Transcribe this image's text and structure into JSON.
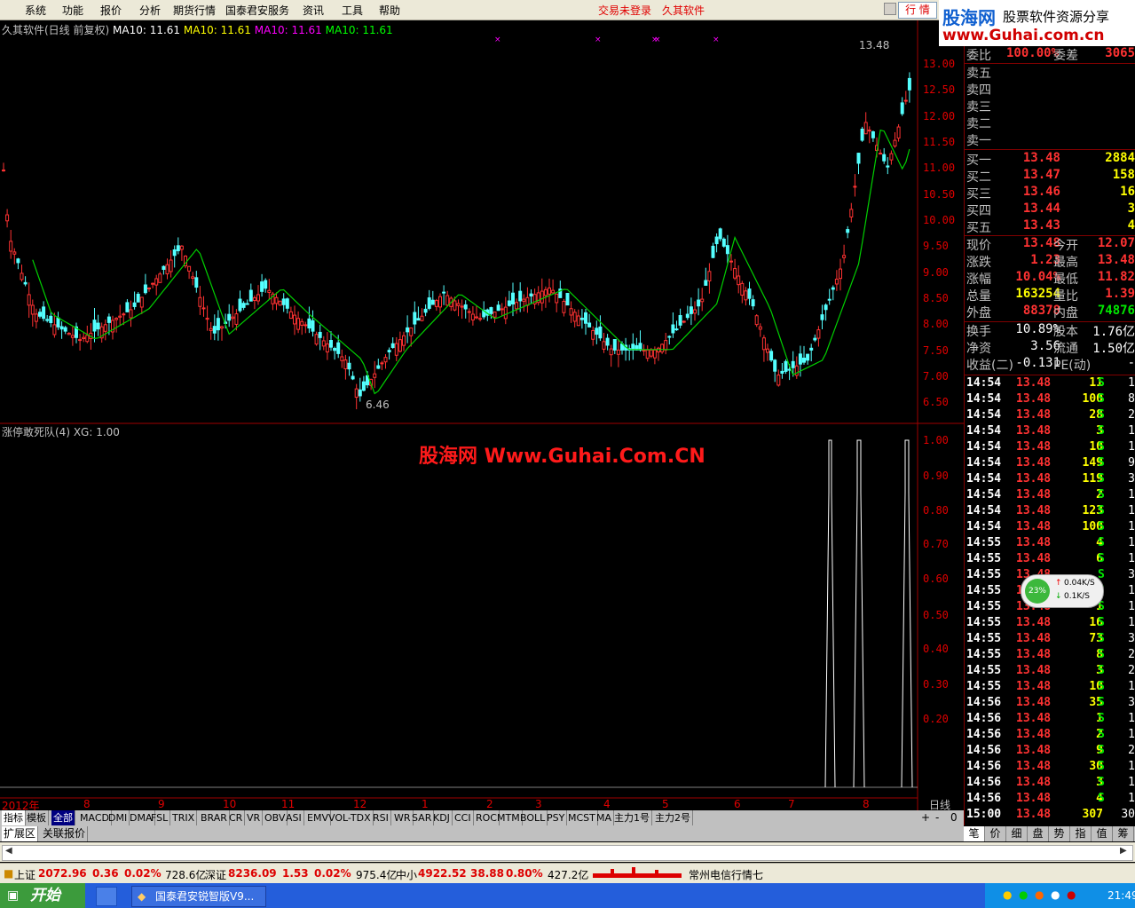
{
  "menubar": {
    "items": [
      "系统",
      "功能",
      "报价",
      "分析",
      "期货行情",
      "国泰君安服务",
      "资讯",
      "工具",
      "帮助"
    ],
    "status_red": [
      "交易未登录",
      "久其软件"
    ],
    "market_tab": "行 情"
  },
  "logo": {
    "name": "股海网",
    "tagline": "股票软件资源分享",
    "url": "www.Guhai.com.cn"
  },
  "main_panel": {
    "title": "久其软件(日线 前复权)",
    "ma_labels": [
      "MA10: 11.61",
      "MA10: 11.61",
      "MA10: 11.61",
      "MA10: 11.61"
    ],
    "ma_colors": [
      "#ffffff",
      "#ffff00",
      "#ff00ff",
      "#00ff00"
    ],
    "y_ticks": [
      "13.00",
      "12.50",
      "12.00",
      "11.50",
      "11.00",
      "10.50",
      "10.00",
      "9.50",
      "9.00",
      "8.50",
      "8.00",
      "7.50",
      "7.00",
      "6.50"
    ],
    "high_marker": "13.48",
    "low_marker": "6.46"
  },
  "indicator_panel": {
    "title": "涨停敢死队(4)  XG: 1.00",
    "y_ticks": [
      "1.00",
      "0.90",
      "0.80",
      "0.70",
      "0.60",
      "0.50",
      "0.40",
      "0.30",
      "0.20"
    ]
  },
  "watermark": "股海网 Www.Guhai.Com.CN",
  "x_axis": {
    "labels": [
      "2012年",
      "8",
      "9",
      "10",
      "11",
      "12",
      "1",
      "2",
      "3",
      "4",
      "5",
      "6",
      "7",
      "8"
    ],
    "period_label": "日线",
    "zoom_buttons": [
      "+",
      "-",
      "0"
    ]
  },
  "indicator_tabs": [
    "指标",
    "模板",
    "全部",
    "MACD",
    "DMI",
    "DMA",
    "FSL",
    "TRIX",
    "BRAR",
    "CR",
    "VR",
    "OBV",
    "ASI",
    "EMV",
    "VOL-TDX",
    "RSI",
    "WR",
    "SAR",
    "KDJ",
    "CCI",
    "ROC",
    "MTM",
    "BOLL",
    "PSY",
    "MCST",
    "MA",
    "主力1号",
    "主力2号"
  ],
  "bottom_tabs": [
    "扩展区",
    "关联报价"
  ],
  "quote": {
    "weibi_label": "委比",
    "weibi_value": "100.00%",
    "weicha_label": "委差",
    "weicha_value": "3065",
    "sell_levels": [
      {
        "label": "卖五",
        "price": "",
        "vol": ""
      },
      {
        "label": "卖四",
        "price": "",
        "vol": ""
      },
      {
        "label": "卖三",
        "price": "",
        "vol": ""
      },
      {
        "label": "卖二",
        "price": "",
        "vol": ""
      },
      {
        "label": "卖一",
        "price": "",
        "vol": ""
      }
    ],
    "buy_levels": [
      {
        "label": "买一",
        "price": "13.48",
        "vol": "2884"
      },
      {
        "label": "买二",
        "price": "13.47",
        "vol": "158"
      },
      {
        "label": "买三",
        "price": "13.46",
        "vol": "16"
      },
      {
        "label": "买四",
        "price": "13.44",
        "vol": "3"
      },
      {
        "label": "买五",
        "price": "13.43",
        "vol": "4"
      }
    ],
    "stats": [
      {
        "l1": "现价",
        "v1": "13.48",
        "c1": "red",
        "l2": "今开",
        "v2": "12.07",
        "c2": "red"
      },
      {
        "l1": "涨跌",
        "v1": "1.23",
        "c1": "red",
        "l2": "最高",
        "v2": "13.48",
        "c2": "red"
      },
      {
        "l1": "涨幅",
        "v1": "10.04%",
        "c1": "red",
        "l2": "最低",
        "v2": "11.82",
        "c2": "red"
      },
      {
        "l1": "总量",
        "v1": "163254",
        "c1": "yel",
        "l2": "量比",
        "v2": "1.39",
        "c2": "red"
      },
      {
        "l1": "外盘",
        "v1": "88378",
        "c1": "red",
        "l2": "内盘",
        "v2": "74876",
        "c2": "green"
      }
    ],
    "fundamentals": [
      {
        "l1": "换手",
        "v1": "10.89%",
        "l2": "股本",
        "v2": "1.76亿"
      },
      {
        "l1": "净资",
        "v1": "3.56",
        "l2": "流通",
        "v2": "1.50亿"
      },
      {
        "l1": "收益(二)",
        "v1": "-0.131",
        "l2": "PE(动)",
        "v2": "-"
      }
    ]
  },
  "ticks": [
    {
      "t": "14:54",
      "p": "13.48",
      "v": "11",
      "s": "S",
      "n": "1"
    },
    {
      "t": "14:54",
      "p": "13.48",
      "v": "100",
      "s": "S",
      "n": "8"
    },
    {
      "t": "14:54",
      "p": "13.48",
      "v": "28",
      "s": "S",
      "n": "2"
    },
    {
      "t": "14:54",
      "p": "13.48",
      "v": "3",
      "s": "S",
      "n": "1"
    },
    {
      "t": "14:54",
      "p": "13.48",
      "v": "10",
      "s": "S",
      "n": "1"
    },
    {
      "t": "14:54",
      "p": "13.48",
      "v": "149",
      "s": "S",
      "n": "9"
    },
    {
      "t": "14:54",
      "p": "13.48",
      "v": "119",
      "s": "S",
      "n": "3"
    },
    {
      "t": "14:54",
      "p": "13.48",
      "v": "2",
      "s": "S",
      "n": "1"
    },
    {
      "t": "14:54",
      "p": "13.48",
      "v": "123",
      "s": "S",
      "n": "1"
    },
    {
      "t": "14:54",
      "p": "13.48",
      "v": "100",
      "s": "S",
      "n": "1"
    },
    {
      "t": "14:55",
      "p": "13.48",
      "v": "4",
      "s": "S",
      "n": "1"
    },
    {
      "t": "14:55",
      "p": "13.48",
      "v": "6",
      "s": "S",
      "n": "1"
    },
    {
      "t": "14:55",
      "p": "13.48",
      "v": "",
      "s": "S",
      "n": "3"
    },
    {
      "t": "14:55",
      "p": "13.48",
      "v": "",
      "s": "S",
      "n": "1"
    },
    {
      "t": "14:55",
      "p": "13.48",
      "v": "1",
      "s": "S",
      "n": "1"
    },
    {
      "t": "14:55",
      "p": "13.48",
      "v": "16",
      "s": "S",
      "n": "1"
    },
    {
      "t": "14:55",
      "p": "13.48",
      "v": "73",
      "s": "S",
      "n": "3"
    },
    {
      "t": "14:55",
      "p": "13.48",
      "v": "8",
      "s": "S",
      "n": "2"
    },
    {
      "t": "14:55",
      "p": "13.48",
      "v": "3",
      "s": "S",
      "n": "2"
    },
    {
      "t": "14:55",
      "p": "13.48",
      "v": "10",
      "s": "S",
      "n": "1"
    },
    {
      "t": "14:56",
      "p": "13.48",
      "v": "35",
      "s": "S",
      "n": "3"
    },
    {
      "t": "14:56",
      "p": "13.48",
      "v": "1",
      "s": "S",
      "n": "1"
    },
    {
      "t": "14:56",
      "p": "13.48",
      "v": "2",
      "s": "S",
      "n": "1"
    },
    {
      "t": "14:56",
      "p": "13.48",
      "v": "9",
      "s": "S",
      "n": "2"
    },
    {
      "t": "14:56",
      "p": "13.48",
      "v": "30",
      "s": "S",
      "n": "1"
    },
    {
      "t": "14:56",
      "p": "13.48",
      "v": "3",
      "s": "S",
      "n": "1"
    },
    {
      "t": "14:56",
      "p": "13.48",
      "v": "4",
      "s": "S",
      "n": "1"
    },
    {
      "t": "15:00",
      "p": "13.48",
      "v": "307",
      "s": "",
      "n": "30"
    }
  ],
  "right_tabs": [
    "笔",
    "价",
    "细",
    "盘",
    "势",
    "指",
    "值",
    "筹"
  ],
  "network": {
    "pct": "23%",
    "up": "0.04K/S",
    "down": "0.1K/S"
  },
  "statusbar": {
    "sh_label": "上证",
    "sh_val": "2072.96",
    "sh_chg": "0.36",
    "sh_pct": "0.02%",
    "sh_amt": "728.6亿",
    "sz_label": "深证",
    "sz_val": "8236.09",
    "sz_chg": "1.53",
    "sz_pct": "0.02%",
    "sz_amt": "975.4亿",
    "zx_label": "中小",
    "zx_val": "4922.52",
    "zx_chg": "38.88",
    "zx_pct": "0.80%",
    "zx_amt": "427.2亿",
    "server": "常州电信行情七"
  },
  "taskbar": {
    "start": "开始",
    "app": "国泰君安锐智版V9...",
    "clock": "21:49"
  }
}
